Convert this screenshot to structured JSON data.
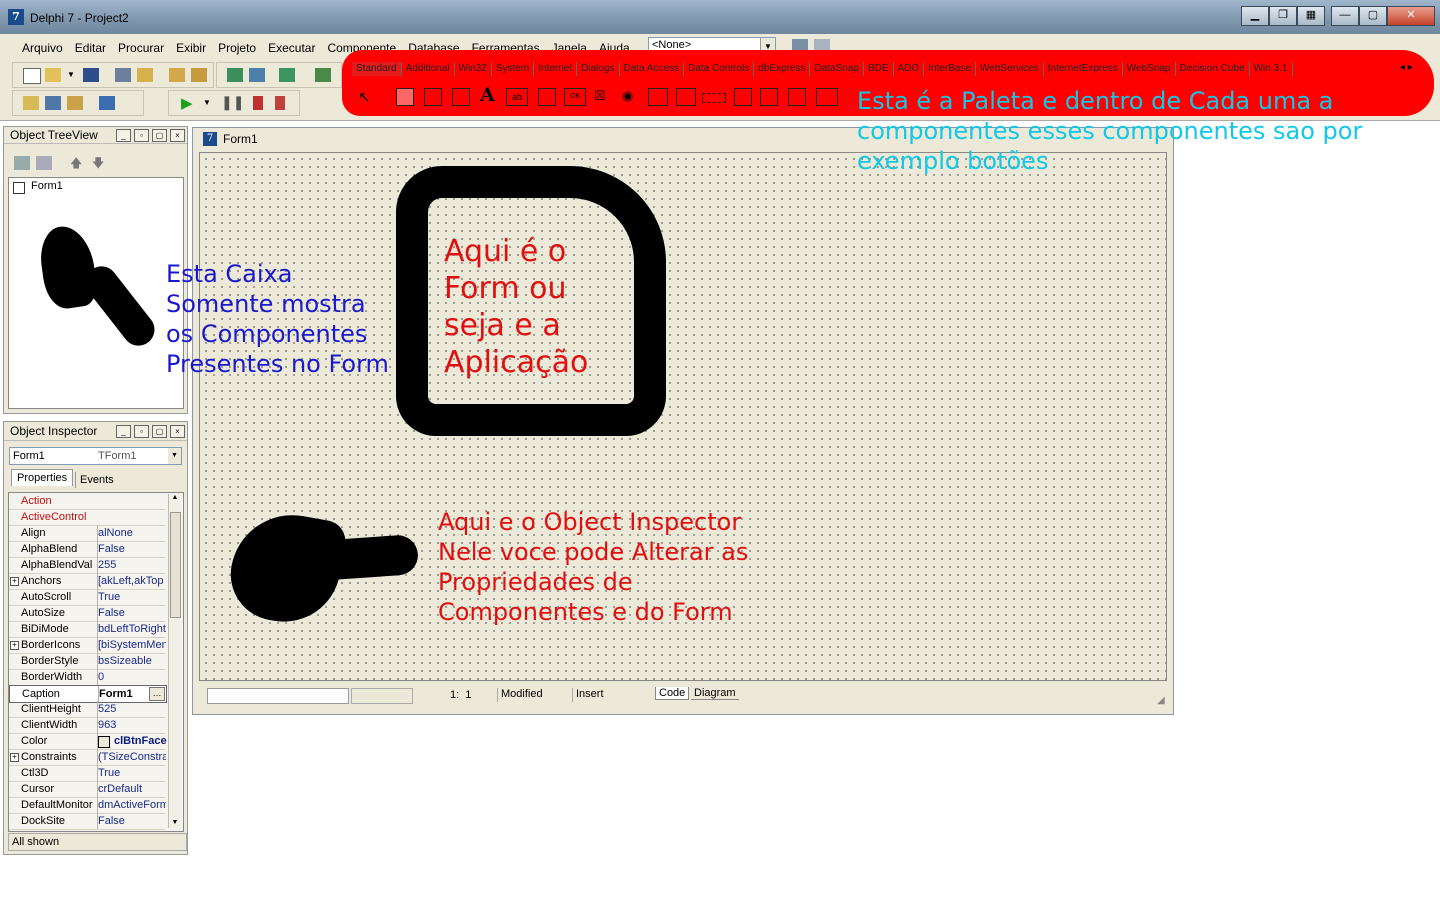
{
  "window": {
    "title": "Delphi 7 - Project2"
  },
  "menu": [
    "Arquivo",
    "Editar",
    "Procurar",
    "Exibir",
    "Projeto",
    "Executar",
    "Componente",
    "Database",
    "Ferramentas",
    "Janela",
    "Ajuda"
  ],
  "config_combo": {
    "value": "<None>"
  },
  "palette_tabs": [
    "Standard",
    "Additional",
    "Win32",
    "System",
    "Internet",
    "Dialogs",
    "Data Access",
    "Data Controls",
    "dbExpress",
    "DataSnap",
    "BDE",
    "ADO",
    "InterBase",
    "WebServices",
    "InternetExpress",
    "WebSnap",
    "Decision Cube",
    "Win 3.1"
  ],
  "treeview": {
    "title": "Object TreeView",
    "root": "Form1"
  },
  "inspector": {
    "title": "Object Inspector",
    "object_name": "Form1",
    "object_type": "TForm1",
    "tabs": [
      "Properties",
      "Events"
    ],
    "status": "All shown",
    "rows": [
      {
        "prop": "Action",
        "value": "",
        "red": true
      },
      {
        "prop": "ActiveControl",
        "value": "",
        "red": true
      },
      {
        "prop": "Align",
        "value": "alNone"
      },
      {
        "prop": "AlphaBlend",
        "value": "False"
      },
      {
        "prop": "AlphaBlendVal",
        "value": "255"
      },
      {
        "prop": "Anchors",
        "value": "[akLeft,akTop",
        "expand": true
      },
      {
        "prop": "AutoScroll",
        "value": "True"
      },
      {
        "prop": "AutoSize",
        "value": "False"
      },
      {
        "prop": "BiDiMode",
        "value": "bdLeftToRight"
      },
      {
        "prop": "BorderIcons",
        "value": "[biSystemMen",
        "expand": true
      },
      {
        "prop": "BorderStyle",
        "value": "bsSizeable"
      },
      {
        "prop": "BorderWidth",
        "value": "0"
      },
      {
        "prop": "Caption",
        "value": "Form1",
        "selected": true
      },
      {
        "prop": "ClientHeight",
        "value": "525"
      },
      {
        "prop": "ClientWidth",
        "value": "963"
      },
      {
        "prop": "Color",
        "value": "clBtnFace",
        "bold": true
      },
      {
        "prop": "Constraints",
        "value": "(TSizeConstra",
        "expand": true
      },
      {
        "prop": "Ctl3D",
        "value": "True"
      },
      {
        "prop": "Cursor",
        "value": "crDefault"
      },
      {
        "prop": "DefaultMonitor",
        "value": "dmActiveForm"
      },
      {
        "prop": "DockSite",
        "value": "False"
      }
    ]
  },
  "form": {
    "caption": "Form1",
    "status": {
      "position": "1:  1",
      "modified": "Modified",
      "mode": "Insert"
    },
    "tabs": [
      "Code",
      "Diagram"
    ]
  },
  "annotations": {
    "palette": [
      "Esta é a Paleta e dentro de Cada uma a",
      "componentes esses componentes sao por",
      "exemplo botões"
    ],
    "treeview": [
      "Esta Caixa",
      "Somente mostra",
      "os Componentes",
      "Presentes no Form"
    ],
    "form": [
      "Aqui é o",
      "Form ou",
      "seja e a",
      "Aplicação"
    ],
    "inspector": [
      "Aqui e o Object Inspector",
      "Nele voce pode Alterar as",
      "Propriedades de",
      "Componentes e do Form"
    ]
  },
  "colors": {
    "annotation_red": "#e01010",
    "annotation_blue": "#1a1acc",
    "annotation_cyan": "#12c8e6",
    "palette_highlight": "#ff0000"
  }
}
